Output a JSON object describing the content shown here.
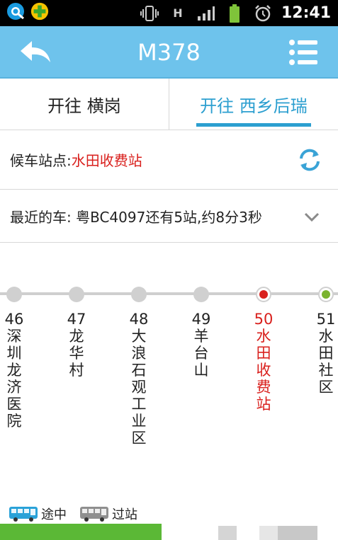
{
  "status_bar": {
    "time": "12:41",
    "network": "H",
    "icons": [
      "qq-browser-icon",
      "security-icon",
      "vibrate-icon",
      "signal-icon",
      "battery-icon",
      "alarm-icon"
    ]
  },
  "header": {
    "title": "M378"
  },
  "tabs": [
    {
      "label": "开往 横岗",
      "active": false
    },
    {
      "label": "开往 西乡后瑞",
      "active": true
    }
  ],
  "station": {
    "label": "候车站点: ",
    "name": "水田收费站"
  },
  "nearest_bus": {
    "text": "最近的车: 粤BC4097还有5站,约8分3秒"
  },
  "stops": [
    {
      "num": "46",
      "name": "深圳龙济医院",
      "state": "normal"
    },
    {
      "num": "47",
      "name": "龙华村",
      "state": "normal"
    },
    {
      "num": "48",
      "name": "大浪石观工业区",
      "state": "normal"
    },
    {
      "num": "49",
      "name": "羊台山",
      "state": "normal"
    },
    {
      "num": "50",
      "name": "水田收费站",
      "state": "current"
    },
    {
      "num": "51",
      "name": "水田社区",
      "state": "next"
    }
  ],
  "legend": {
    "en_route": "途中",
    "passed": "过站"
  },
  "colors": {
    "header_bg": "#6ec3ec",
    "accent": "#2c9fd0",
    "current_station": "#d9201d",
    "next_stop": "#7ab32e"
  }
}
